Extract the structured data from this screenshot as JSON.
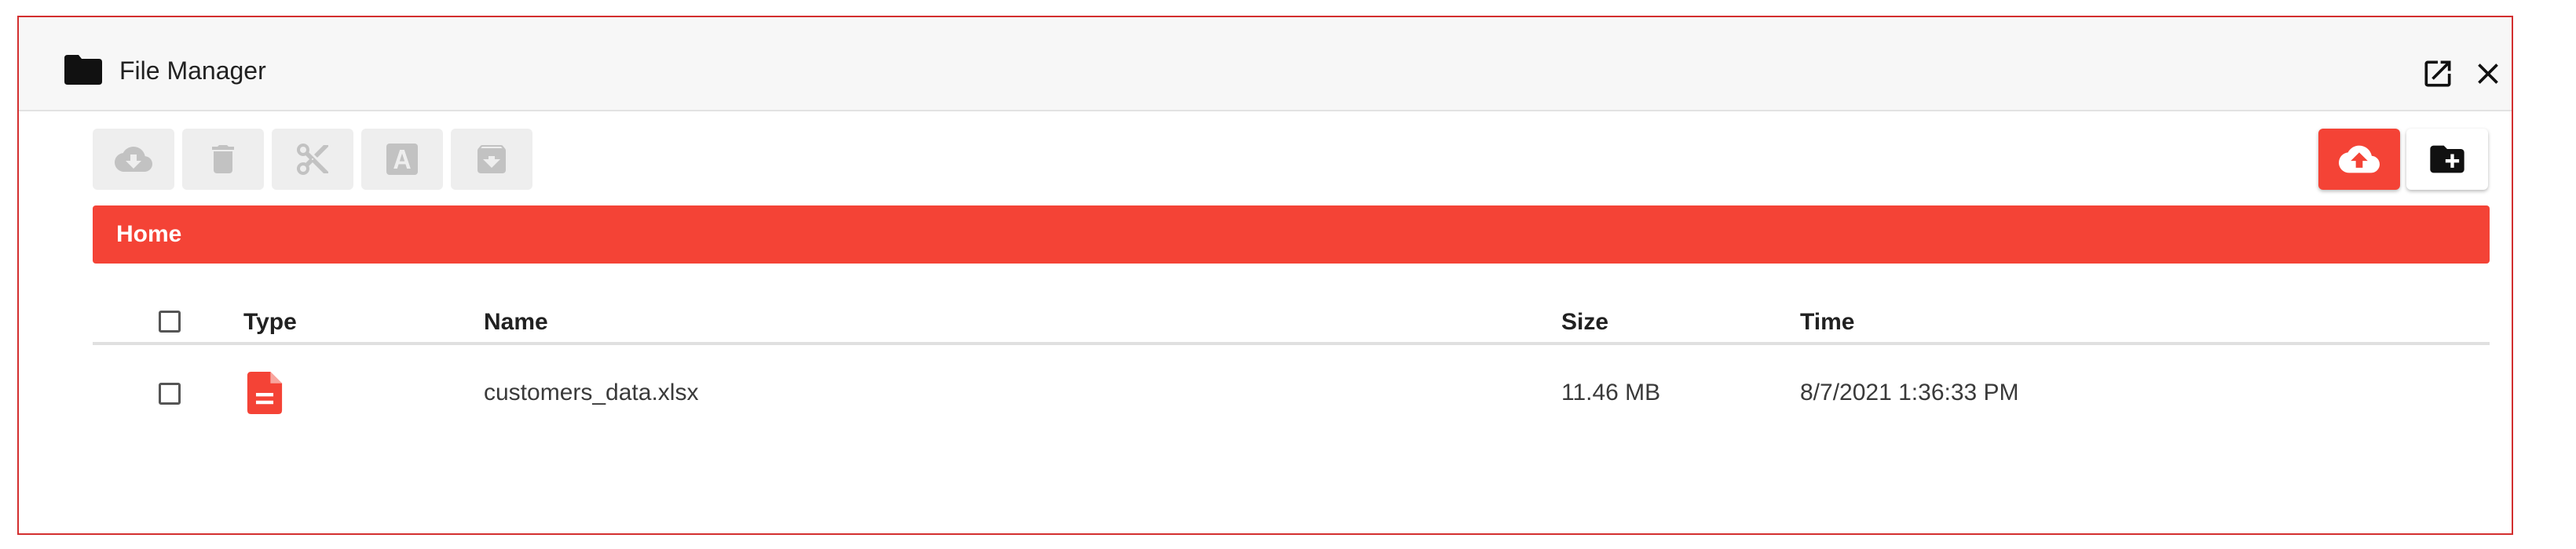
{
  "window": {
    "title": "File Manager",
    "title_icon": "folder-icon",
    "popout_icon": "open-in-new-icon",
    "close_icon": "close-icon"
  },
  "toolbar": {
    "buttons": [
      {
        "name": "download",
        "icon": "cloud-download-icon",
        "enabled": false
      },
      {
        "name": "delete",
        "icon": "trash-icon",
        "enabled": false
      },
      {
        "name": "cut",
        "icon": "scissors-icon",
        "enabled": false
      },
      {
        "name": "rename",
        "icon": "rename-icon",
        "enabled": false
      },
      {
        "name": "archive",
        "icon": "archive-icon",
        "enabled": false
      }
    ],
    "actions": [
      {
        "name": "upload",
        "icon": "cloud-upload-icon"
      },
      {
        "name": "new-folder",
        "icon": "create-folder-icon"
      }
    ]
  },
  "breadcrumb": {
    "items": [
      "Home"
    ]
  },
  "table": {
    "columns": [
      "Type",
      "Name",
      "Size",
      "Time"
    ],
    "rows": [
      {
        "type_icon": "file-document-icon",
        "name": "customers_data.xlsx",
        "size": "11.46 MB",
        "time": "8/7/2021 1:36:33 PM",
        "checked": false
      }
    ]
  },
  "colors": {
    "accent": "#f44336",
    "border": "#d32f2f",
    "disabled_bg": "#eeeeee",
    "disabled_icon": "#c2c2c2",
    "titlebar_bg": "#f7f7f7"
  }
}
